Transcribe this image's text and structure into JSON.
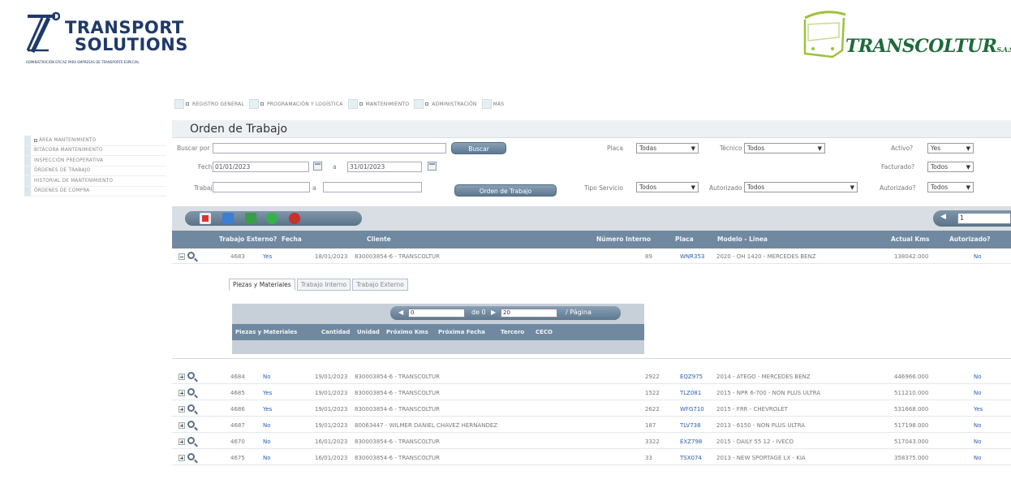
{
  "header": {
    "left_logo": {
      "line1": "TRANSPORT",
      "line2": "SOLUTIONS",
      "tagline": "ADMINISTRACIÓN EFICAZ PARA EMPRESAS DE TRANSPORTE ESPECIAL"
    },
    "right_logo": {
      "name": "TRANSCOLTUR",
      "suffix": "S.A.S"
    }
  },
  "top_tabs": [
    {
      "label": "REGISTRO GENERAL"
    },
    {
      "label": "PROGRAMACIÓN Y LOGÍSTICA"
    },
    {
      "label": "MANTENIMIENTO"
    },
    {
      "label": "ADMINISTRACIÓN"
    },
    {
      "label": "MÁS"
    }
  ],
  "sidebar": {
    "items": [
      {
        "label": "ÁREA MANTENIMIENTO"
      },
      {
        "label": "BITÁCORA MANTENIMIENTO"
      },
      {
        "label": "INSPECCIÓN PREOPERATIVA"
      },
      {
        "label": "ÓRDENES DE TRABAJO"
      },
      {
        "label": "HISTORIAL DE MANTENIMIENTO"
      },
      {
        "label": "ÓRDENES DE COMPRA"
      }
    ]
  },
  "panel": {
    "title": "Orden de Trabajo"
  },
  "filters": {
    "buscar_por_label": "Buscar por",
    "buscar_por_value": "",
    "buscar_button": "Buscar",
    "fecha_label": "Fecha",
    "fecha_from": "01/01/2023",
    "fecha_sep": "a",
    "fecha_to": "31/01/2023",
    "trabajo_label": "Trabajo",
    "trabajo_from": "",
    "trabajo_sep": "a",
    "trabajo_to": "",
    "orden_button": "Orden de Trabajo",
    "placa_label": "Placa",
    "placa_value": "Todas",
    "tecnico_label": "Técnico",
    "tecnico_value": "Todos",
    "activo_label": "Activo?",
    "activo_value": "Yes",
    "facturado_label": "Facturado?",
    "facturado_value": "Todos",
    "tipo_servicio_label": "Tipo Servicio",
    "tipo_servicio_value": "Todos",
    "autorizado_por_label": "Autorizado",
    "autorizado_por_value": "Todos",
    "autorizado_label": "Autorizado?",
    "autorizado_value": "Todos"
  },
  "pager": {
    "page_value": "1"
  },
  "table": {
    "headers": [
      "Trabajo",
      "Externo?",
      "Fecha",
      "Cliente",
      "Número Interno",
      "Placa",
      "Modelo - Linea",
      "Actual Kms",
      "Autorizado?"
    ],
    "expanded_row": {
      "trabajo": "4683",
      "externo": "Yes",
      "fecha": "18/01/2023",
      "cliente": "830003854-6 - TRANSCOLTUR",
      "interno": "89",
      "placa": "WNR353",
      "modelo": "2020 - OH 1420 - MERCEDES BENZ",
      "kms": "138042.000",
      "autorizado": "No"
    },
    "rows": [
      {
        "trabajo": "4684",
        "externo": "No",
        "fecha": "19/01/2023",
        "cliente": "830003854-6 - TRANSCOLTUR",
        "interno": "2922",
        "placa": "EQZ975",
        "modelo": "2014 - ATEGO - MERCEDES BENZ",
        "kms": "446966.000",
        "autorizado": "No"
      },
      {
        "trabajo": "4685",
        "externo": "Yes",
        "fecha": "19/01/2023",
        "cliente": "830003854-6 - TRANSCOLTUR",
        "interno": "1522",
        "placa": "TLZ081",
        "modelo": "2015 - NPR 6-700 - NON PLUS ULTRA",
        "kms": "511210.000",
        "autorizado": "No"
      },
      {
        "trabajo": "4686",
        "externo": "Yes",
        "fecha": "19/01/2023",
        "cliente": "830003854-6 - TRANSCOLTUR",
        "interno": "2622",
        "placa": "WFG710",
        "modelo": "2015 - FRR - CHEVROLET",
        "kms": "531668.000",
        "autorizado": "Yes"
      },
      {
        "trabajo": "4687",
        "externo": "No",
        "fecha": "19/01/2023",
        "cliente": "80063447 - WILMER DANIEL CHAVEZ HERNANDEZ",
        "interno": "187",
        "placa": "TLV738",
        "modelo": "2013 - 6150 - NON PLUS ULTRA",
        "kms": "517198.000",
        "autorizado": "No"
      },
      {
        "trabajo": "4670",
        "externo": "No",
        "fecha": "16/01/2023",
        "cliente": "830003854-6 - TRANSCOLTUR",
        "interno": "3322",
        "placa": "EXZ798",
        "modelo": "2015 - DAILY 55 12 - IVECO",
        "kms": "517043.000",
        "autorizado": "No"
      },
      {
        "trabajo": "4675",
        "externo": "No",
        "fecha": "16/01/2023",
        "cliente": "830003854-6 - TRANSCOLTUR",
        "interno": "33",
        "placa": "TSX074",
        "modelo": "2013 - NEW SPORTAGE LX - KIA",
        "kms": "358375.000",
        "autorizado": "No"
      }
    ]
  },
  "sub_detail": {
    "tabs": [
      {
        "label": "Piezas y Materiales"
      },
      {
        "label": "Trabajo Interno"
      },
      {
        "label": "Trabajo Externo"
      }
    ],
    "pager": {
      "current": "0",
      "of_label": "de 0",
      "page_size": "20",
      "per_page_label": "/ Página"
    },
    "headers": [
      "Piezas y Materiales",
      "Cantidad",
      "Unidad",
      "Próximo Kms",
      "Próxima Fecha",
      "Tercero",
      "CECO"
    ]
  },
  "colors": {
    "header_bar": "#7189a0",
    "link": "#2a5fb0",
    "brand_blue": "#1f3a69",
    "brand_green": "#1e6b3a"
  }
}
